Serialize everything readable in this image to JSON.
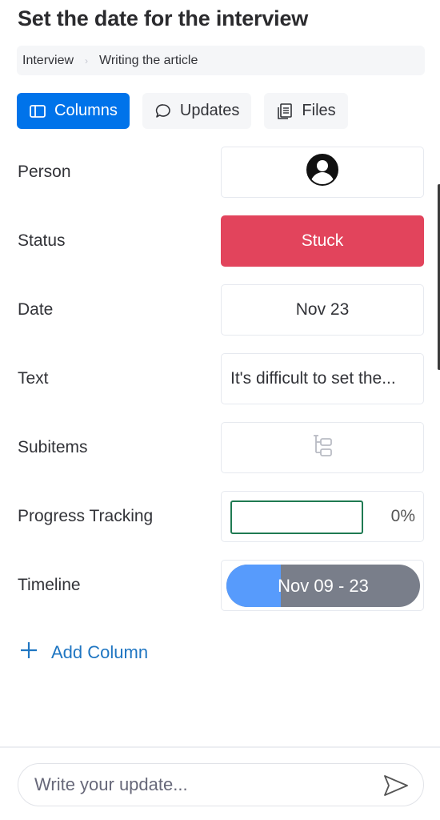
{
  "header": {
    "title": "Set the date for the interview"
  },
  "breadcrumb": {
    "items": [
      "Interview",
      "Writing the article"
    ],
    "separator": "›"
  },
  "tabs": [
    {
      "label": "Columns",
      "icon": "columns-icon",
      "active": true
    },
    {
      "label": "Updates",
      "icon": "chat-bubble-icon",
      "active": false
    },
    {
      "label": "Files",
      "icon": "files-icon",
      "active": false
    }
  ],
  "columns": {
    "person": {
      "label": "Person",
      "icon": "user-avatar-icon"
    },
    "status": {
      "label": "Status",
      "value": "Stuck",
      "color": "#e2445c"
    },
    "date": {
      "label": "Date",
      "value": "Nov 23"
    },
    "text": {
      "label": "Text",
      "value": "It's difficult to set the..."
    },
    "subitems": {
      "label": "Subitems",
      "icon": "subitems-icon"
    },
    "progress": {
      "label": "Progress Tracking",
      "value_percent": 0,
      "display": "0%"
    },
    "timeline": {
      "label": "Timeline",
      "value": "Nov 09 - 23",
      "elapsed_fraction": 0.28
    }
  },
  "actions": {
    "add_column": "Add Column"
  },
  "composer": {
    "placeholder": "Write your update...",
    "value": ""
  },
  "colors": {
    "accent": "#0073ea",
    "stuck": "#e2445c",
    "timeline_elapsed": "#579bfc",
    "timeline_remaining": "#797e8a",
    "progress_border": "#1f7a52"
  }
}
